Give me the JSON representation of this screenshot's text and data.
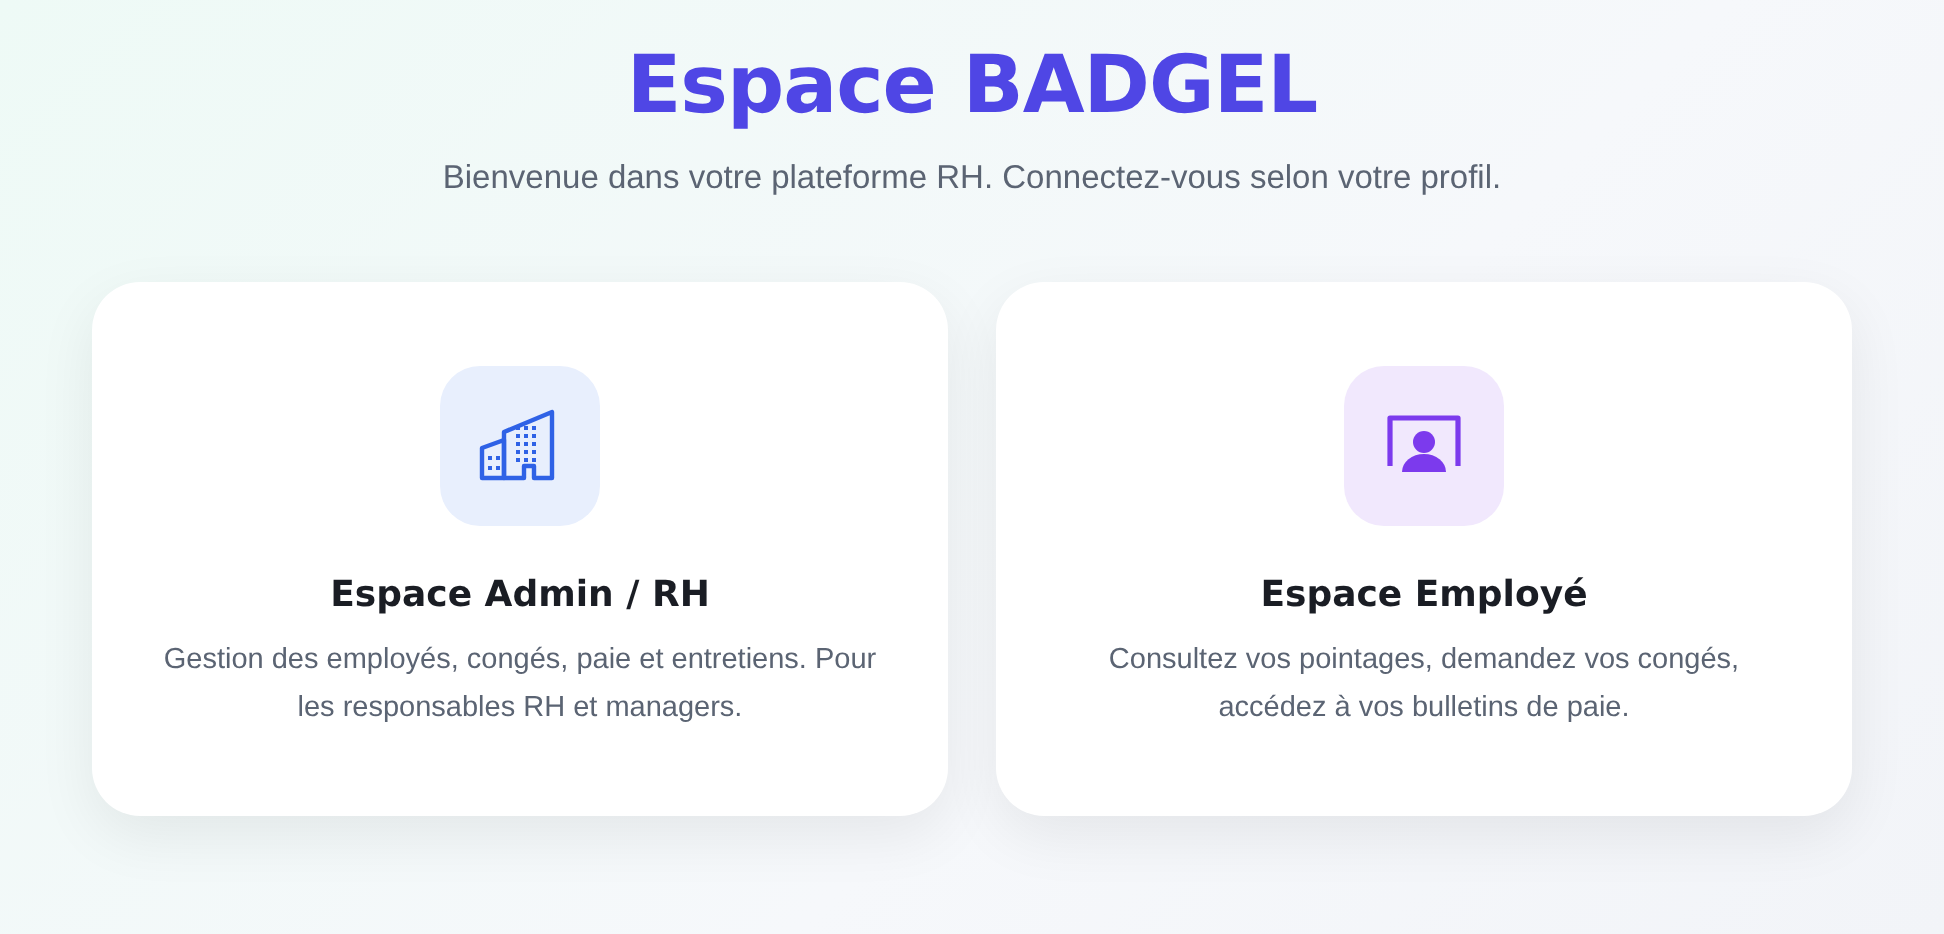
{
  "title": "Espace BADGEL",
  "subtitle": "Bienvenue dans votre plateforme RH. Connectez-vous selon votre profil.",
  "cards": [
    {
      "kind": "admin",
      "title": "Espace Admin / RH",
      "description": "Gestion des employés, congés, paie et entretiens. Pour les responsables RH et managers."
    },
    {
      "kind": "employee",
      "title": "Espace Employé",
      "description": "Consultez vos pointages, demandez vos congés, accédez à vos bulletins de paie."
    }
  ]
}
